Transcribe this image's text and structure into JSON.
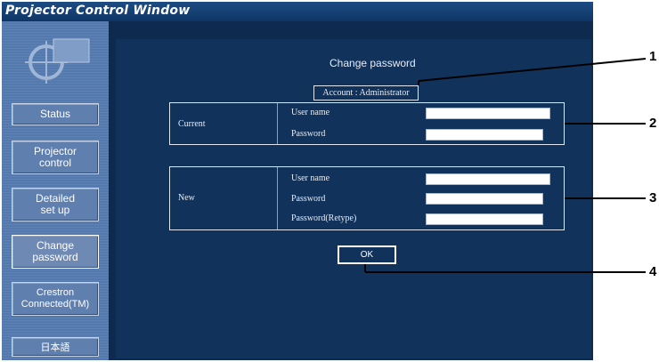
{
  "window": {
    "title": "Projector Control Window"
  },
  "sidebar": {
    "items": [
      {
        "label": "Status"
      },
      {
        "label": "Projector\ncontrol"
      },
      {
        "label": "Detailed\nset up"
      },
      {
        "label": "Change\npassword"
      },
      {
        "label": "Crestron\nConnected(TM)"
      },
      {
        "label": "日本語"
      }
    ]
  },
  "form": {
    "heading": "Change password",
    "account": "Account : Administrator",
    "current": {
      "label": "Current",
      "username_label": "User name",
      "password_label": "Password",
      "username_value": "",
      "password_value": ""
    },
    "new": {
      "label": "New",
      "username_label": "User name",
      "password_label": "Password",
      "retype_label": "Password(Retype)",
      "username_value": "",
      "password_value": "",
      "retype_value": ""
    },
    "ok_label": "OK"
  },
  "callouts": [
    "1",
    "2",
    "3",
    "4"
  ]
}
